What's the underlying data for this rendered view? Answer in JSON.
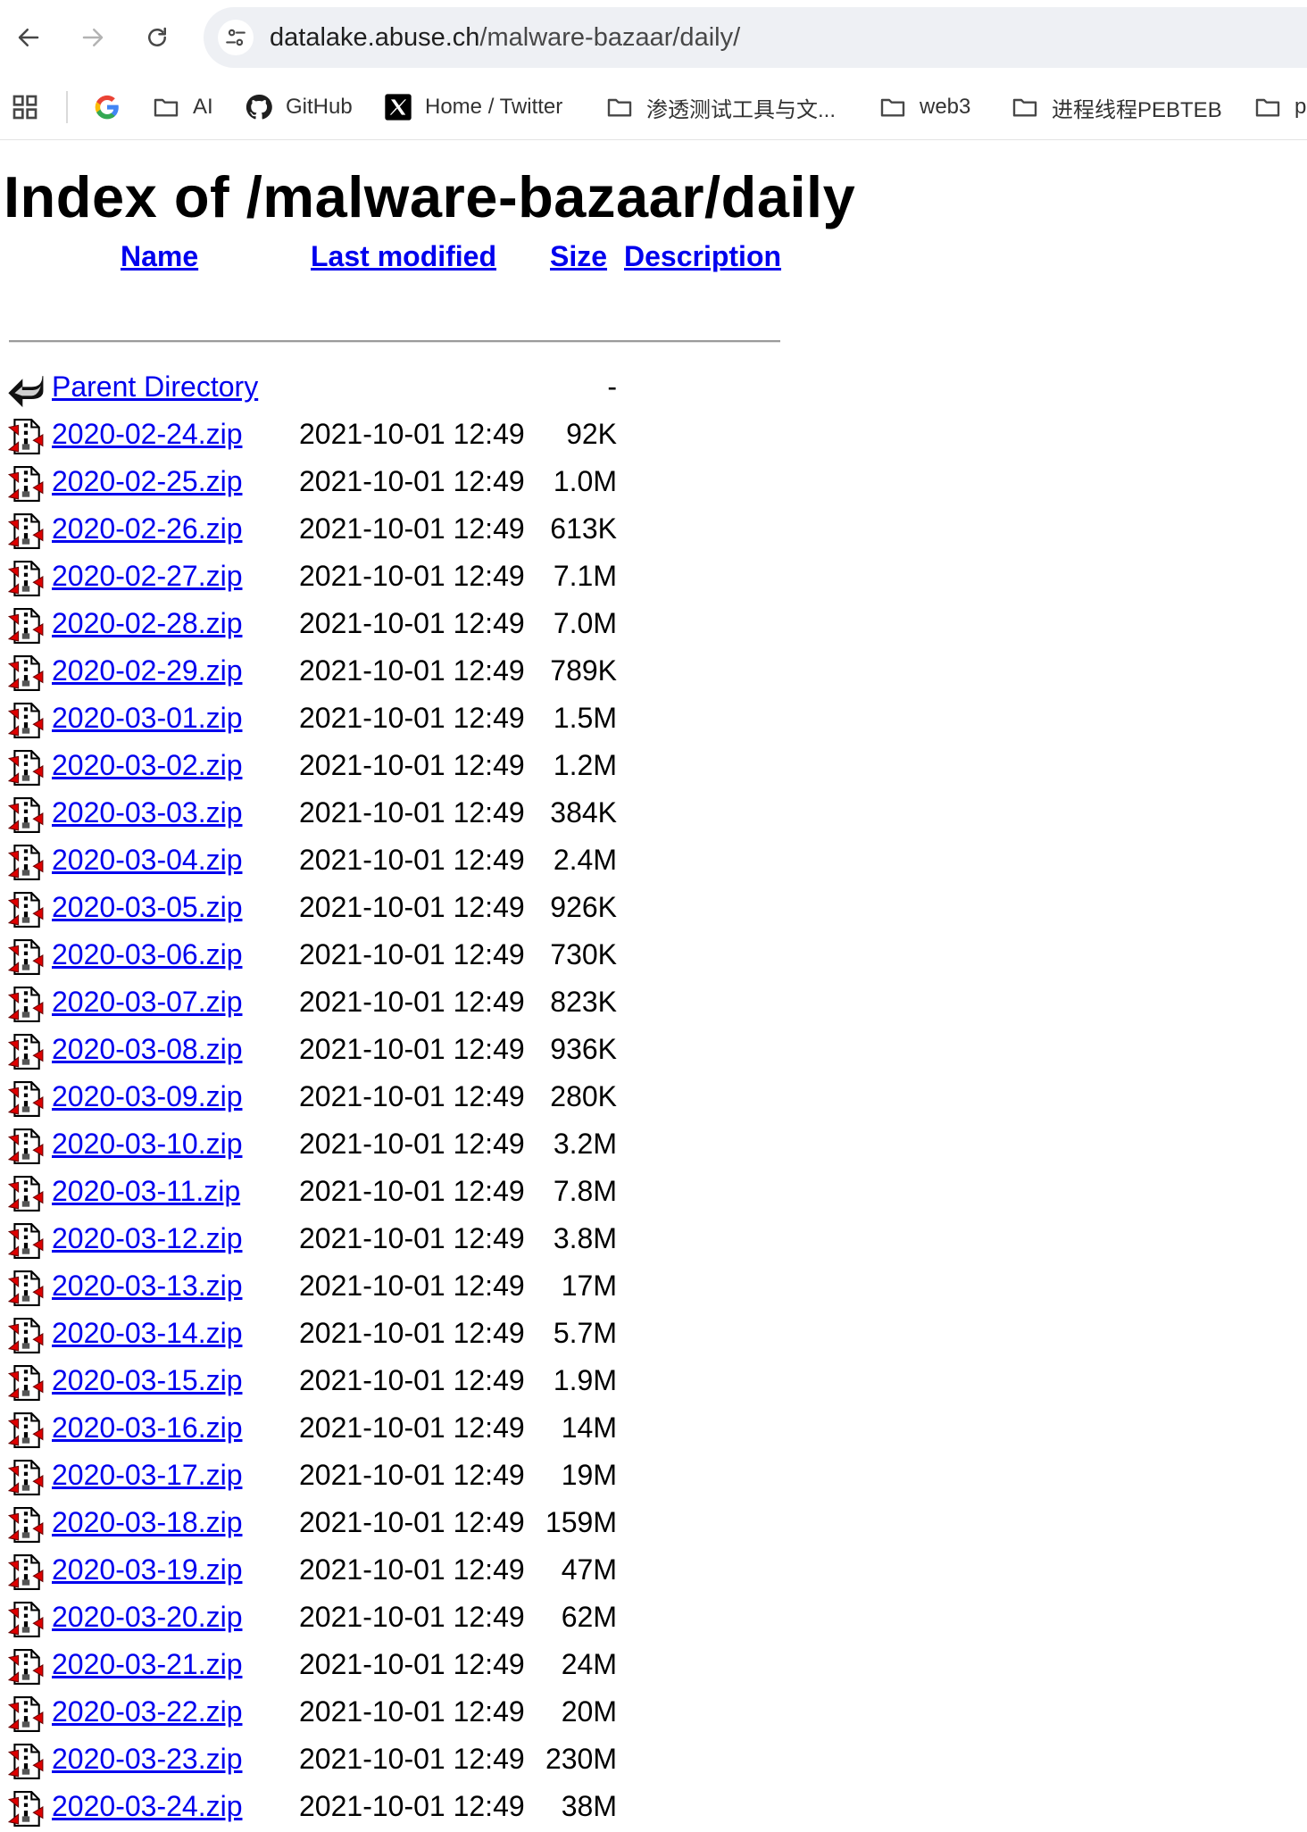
{
  "browser": {
    "url_host": "datalake.abuse.ch",
    "url_path": "/malware-bazaar/daily/",
    "bookmarks": [
      {
        "label": "",
        "icon": "google-icon"
      },
      {
        "label": "AI",
        "icon": "folder-icon"
      },
      {
        "label": "GitHub",
        "icon": "github-icon"
      },
      {
        "label": "Home / Twitter",
        "icon": "x-icon"
      },
      {
        "label": "渗透测试工具与文...",
        "icon": "folder-icon"
      },
      {
        "label": "web3",
        "icon": "folder-icon"
      },
      {
        "label": "进程线程PEBTEB",
        "icon": "folder-icon"
      },
      {
        "label": "p",
        "icon": "folder-icon"
      }
    ]
  },
  "page": {
    "title": "Index of /malware-bazaar/daily",
    "columns": {
      "name": "Name",
      "last_modified": "Last modified",
      "size": "Size",
      "description": "Description"
    },
    "parent": {
      "name": "Parent Directory",
      "size": "-"
    },
    "files": [
      {
        "name": "2020-02-24.zip",
        "modified": "2021-10-01 12:49",
        "size": "92K"
      },
      {
        "name": "2020-02-25.zip",
        "modified": "2021-10-01 12:49",
        "size": "1.0M"
      },
      {
        "name": "2020-02-26.zip",
        "modified": "2021-10-01 12:49",
        "size": "613K"
      },
      {
        "name": "2020-02-27.zip",
        "modified": "2021-10-01 12:49",
        "size": "7.1M"
      },
      {
        "name": "2020-02-28.zip",
        "modified": "2021-10-01 12:49",
        "size": "7.0M"
      },
      {
        "name": "2020-02-29.zip",
        "modified": "2021-10-01 12:49",
        "size": "789K"
      },
      {
        "name": "2020-03-01.zip",
        "modified": "2021-10-01 12:49",
        "size": "1.5M"
      },
      {
        "name": "2020-03-02.zip",
        "modified": "2021-10-01 12:49",
        "size": "1.2M"
      },
      {
        "name": "2020-03-03.zip",
        "modified": "2021-10-01 12:49",
        "size": "384K"
      },
      {
        "name": "2020-03-04.zip",
        "modified": "2021-10-01 12:49",
        "size": "2.4M"
      },
      {
        "name": "2020-03-05.zip",
        "modified": "2021-10-01 12:49",
        "size": "926K"
      },
      {
        "name": "2020-03-06.zip",
        "modified": "2021-10-01 12:49",
        "size": "730K"
      },
      {
        "name": "2020-03-07.zip",
        "modified": "2021-10-01 12:49",
        "size": "823K"
      },
      {
        "name": "2020-03-08.zip",
        "modified": "2021-10-01 12:49",
        "size": "936K"
      },
      {
        "name": "2020-03-09.zip",
        "modified": "2021-10-01 12:49",
        "size": "280K"
      },
      {
        "name": "2020-03-10.zip",
        "modified": "2021-10-01 12:49",
        "size": "3.2M"
      },
      {
        "name": "2020-03-11.zip",
        "modified": "2021-10-01 12:49",
        "size": "7.8M"
      },
      {
        "name": "2020-03-12.zip",
        "modified": "2021-10-01 12:49",
        "size": "3.8M"
      },
      {
        "name": "2020-03-13.zip",
        "modified": "2021-10-01 12:49",
        "size": "17M"
      },
      {
        "name": "2020-03-14.zip",
        "modified": "2021-10-01 12:49",
        "size": "5.7M"
      },
      {
        "name": "2020-03-15.zip",
        "modified": "2021-10-01 12:49",
        "size": "1.9M"
      },
      {
        "name": "2020-03-16.zip",
        "modified": "2021-10-01 12:49",
        "size": "14M"
      },
      {
        "name": "2020-03-17.zip",
        "modified": "2021-10-01 12:49",
        "size": "19M"
      },
      {
        "name": "2020-03-18.zip",
        "modified": "2021-10-01 12:49",
        "size": "159M"
      },
      {
        "name": "2020-03-19.zip",
        "modified": "2021-10-01 12:49",
        "size": "47M"
      },
      {
        "name": "2020-03-20.zip",
        "modified": "2021-10-01 12:49",
        "size": "62M"
      },
      {
        "name": "2020-03-21.zip",
        "modified": "2021-10-01 12:49",
        "size": "24M"
      },
      {
        "name": "2020-03-22.zip",
        "modified": "2021-10-01 12:49",
        "size": "20M"
      },
      {
        "name": "2020-03-23.zip",
        "modified": "2021-10-01 12:49",
        "size": "230M"
      },
      {
        "name": "2020-03-24.zip",
        "modified": "2021-10-01 12:49",
        "size": "38M"
      }
    ]
  }
}
